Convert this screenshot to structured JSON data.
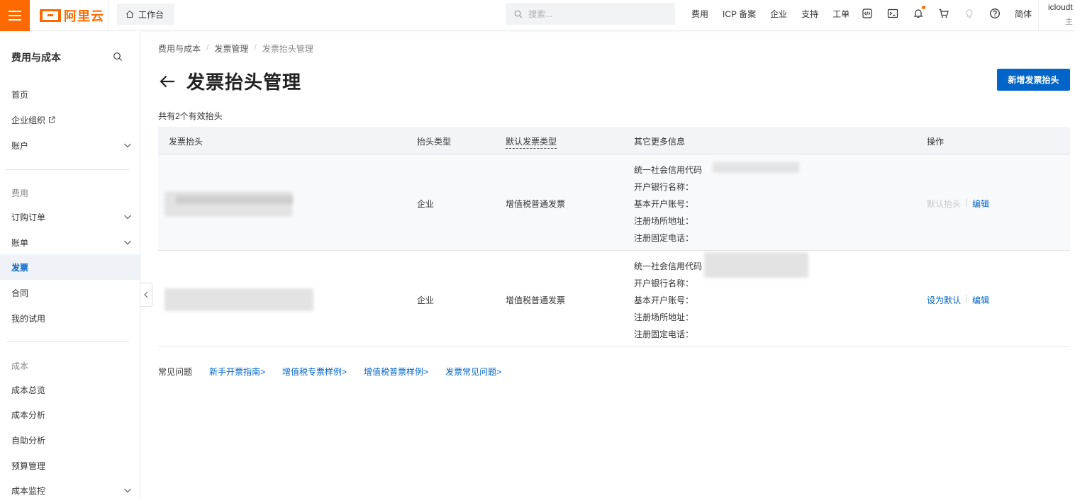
{
  "topbar": {
    "brand": "阿里云",
    "workbench": "工作台",
    "search_placeholder": "搜索...",
    "links": [
      "费用",
      "ICP 备案",
      "企业",
      "支持",
      "工单"
    ],
    "icons": [
      "code-icon",
      "terminal-icon",
      "bell-icon",
      "cart-icon",
      "bulb-icon",
      "help-icon"
    ],
    "language": "简体",
    "user": "icloudt",
    "user_sub": "主"
  },
  "sidebar": {
    "title": "费用与成本",
    "items_top": [
      {
        "label": "首页"
      },
      {
        "label": "企业组织"
      },
      {
        "label": "账户"
      }
    ],
    "group_fee": "费用",
    "items_fee": [
      {
        "label": "订购订单"
      },
      {
        "label": "账单"
      },
      {
        "label": "发票"
      },
      {
        "label": "合同"
      },
      {
        "label": "我的试用"
      }
    ],
    "group_cost": "成本",
    "items_cost": [
      {
        "label": "成本总览"
      },
      {
        "label": "成本分析"
      },
      {
        "label": "自助分析"
      },
      {
        "label": "预算管理"
      },
      {
        "label": "成本监控"
      }
    ]
  },
  "breadcrumb": [
    "费用与成本",
    "发票管理",
    "发票抬头管理"
  ],
  "page": {
    "title": "发票抬头管理",
    "new_button": "新增发票抬头",
    "count_text": "共有2个有效抬头"
  },
  "table": {
    "headers": [
      "发票抬头",
      "抬头类型",
      "默认发票类型",
      "其它更多信息",
      "操作"
    ],
    "rows": [
      {
        "type": "企业",
        "invoice_type": "增值税普通发票",
        "info": [
          "统一社会信用代码",
          "开户银行名称：",
          "基本开户账号：",
          "注册场所地址：",
          "注册固定电话："
        ],
        "op1": "默认抬头",
        "op2": "编辑"
      },
      {
        "type": "企业",
        "invoice_type": "增值税普通发票",
        "info": [
          "统一社会信用代码",
          "开户银行名称：",
          "基本开户账号：",
          "注册场所地址：",
          "注册固定电话："
        ],
        "op1": "设为默认",
        "op2": "编辑"
      }
    ]
  },
  "faq": {
    "label": "常见问题",
    "links": [
      "新手开票指南>",
      "增值税专票样例>",
      "增值税普票样例>",
      "发票常见问题>"
    ]
  },
  "colors": {
    "brand": "#ff6a00",
    "primary": "#0064c8"
  }
}
